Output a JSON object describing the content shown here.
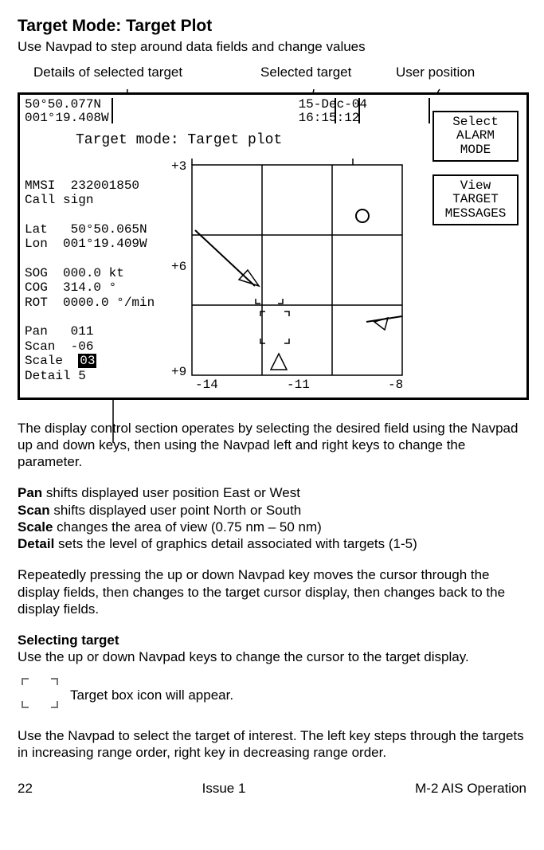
{
  "title": "Target Mode: Target Plot",
  "subtitle": "Use Navpad to step around data fields and change values",
  "callouts": {
    "details": "Details of selected target",
    "selected": "Selected target",
    "user": "User position"
  },
  "screen": {
    "lat": "50°50.077N",
    "lon": "001°19.408W",
    "date": "15-Dec-04",
    "time": "16:15:12",
    "modeTitle": "Target mode: Target plot",
    "btn1": "Select\nALARM\nMODE",
    "btn2": "View\nTARGET\nMESSAGES",
    "details": {
      "l1": "MMSI  232001850",
      "l2": "Call sign",
      "l3": "",
      "l4": "Lat   50°50.065N",
      "l5": "Lon  001°19.409W",
      "l6": "",
      "l7": "SOG  000.0 kt",
      "l8": "COG  314.0 °",
      "l9": "ROT  0000.0 °/min",
      "l10": "",
      "l11": "Pan   011",
      "l12": "Scan  -06",
      "l13a": "Scale  ",
      "l13b": "03",
      "l14": "Detail 5"
    },
    "ylabels": {
      "t1": "+3",
      "t2": "+6",
      "t3": "+9"
    },
    "xlabels": {
      "x1": "-14",
      "x2": "-11",
      "x3": "-8"
    }
  },
  "body": {
    "p1": "The display control section operates by selecting the desired field using the Navpad up and down keys, then using the Navpad left and right keys to change the parameter.",
    "pan_b": "Pan",
    "pan_t": " shifts displayed user position East or West",
    "scan_b": "Scan",
    "scan_t": " shifts displayed user point North or South",
    "scale_b": "Scale",
    "scale_t": " changes the area of view (0.75 nm – 50 nm)",
    "detail_b": "Detail",
    "detail_t": " sets the level of graphics detail associated with targets (1-5)",
    "p2": "Repeatedly pressing the up or down Navpad key moves the cursor through the display fields, then changes to the target cursor display, then changes back to the display fields.",
    "seltitle": "Selecting target",
    "p3": "Use the up or down Navpad keys to change the cursor to the target display.",
    "tbox": "Target box icon will appear.",
    "p4": "Use the Navpad to select the target of interest. The left key steps through the targets in increasing range order, right key in decreasing range order."
  },
  "footer": {
    "page": "22",
    "issue": "Issue 1",
    "doc": "M-2 AIS Operation"
  }
}
